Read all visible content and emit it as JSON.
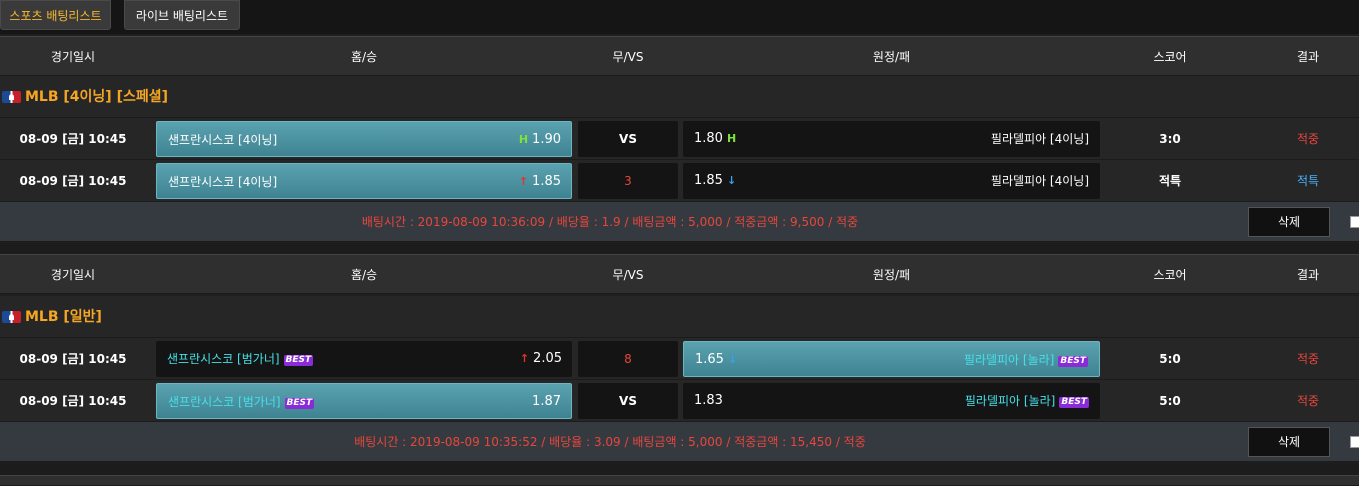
{
  "tabs": [
    {
      "label": "스포츠 배팅리스트",
      "active": true
    },
    {
      "label": "라이브 배팅리스트",
      "active": false
    }
  ],
  "columns": {
    "date": "경기일시",
    "home": "홈/승",
    "draw": "무/VS",
    "away": "원정/패",
    "score": "스코어",
    "result": "결과"
  },
  "slips": [
    {
      "league": "MLB [4이닝] [스페셜]",
      "bets": [
        {
          "date": "08-09 [금] 10:45",
          "home_team": "샌프란시스코 [4이닝]",
          "home_indicator": "H",
          "home_odds": "1.90",
          "mid": "VS",
          "away_odds": "1.80",
          "away_indicator": "H",
          "away_team": "필라델피아 [4이닝]",
          "score": "3:0",
          "result": "적중",
          "selected": "home"
        },
        {
          "date": "08-09 [금] 10:45",
          "home_team": "샌프란시스코 [4이닝]",
          "home_indicator": "↑",
          "home_odds": "1.85",
          "mid": "3",
          "away_odds": "1.85",
          "away_indicator": "↓",
          "away_team": "필라델피아 [4이닝]",
          "score": "적특",
          "result": "적특",
          "selected": "home"
        }
      ],
      "summary": "배팅시간 : 2019-08-09 10:36:09  /  배당율 : 1.9  /  배팅금액 : 5,000  /  적중금액 : 9,500  / 적중",
      "delete_label": "삭제"
    },
    {
      "league": "MLB [일반]",
      "bets": [
        {
          "date": "08-09 [금] 10:45",
          "home_team": "샌프란시스코 [범가너]",
          "home_best": "BEST",
          "home_indicator": "↑",
          "home_odds": "2.05",
          "mid": "8",
          "away_odds": "1.65",
          "away_indicator": "↓",
          "away_team": "필라델피아 [놀라]",
          "away_best": "BEST",
          "score": "5:0",
          "result": "적중",
          "selected": "away"
        },
        {
          "date": "08-09 [금] 10:45",
          "home_team": "샌프란시스코 [범가너]",
          "home_best": "BEST",
          "home_indicator": "",
          "home_odds": "1.87",
          "mid": "VS",
          "away_odds": "1.83",
          "away_indicator": "",
          "away_team": "필라델피아 [놀라]",
          "away_best": "BEST",
          "score": "5:0",
          "result": "적중",
          "selected": "home"
        }
      ],
      "summary": "배팅시간 : 2019-08-09 10:35:52  /  배당율 : 3.09  /  배팅금액 : 5,000  /  적중금액 : 15,450  / 적중",
      "delete_label": "삭제"
    }
  ],
  "colors": {
    "accent_orange": "#f5a623",
    "win_red": "#e8463c",
    "special_blue": "#4ab2ff",
    "selected_teal": "#4a93a2",
    "best_purple": "#8a2bd8"
  }
}
